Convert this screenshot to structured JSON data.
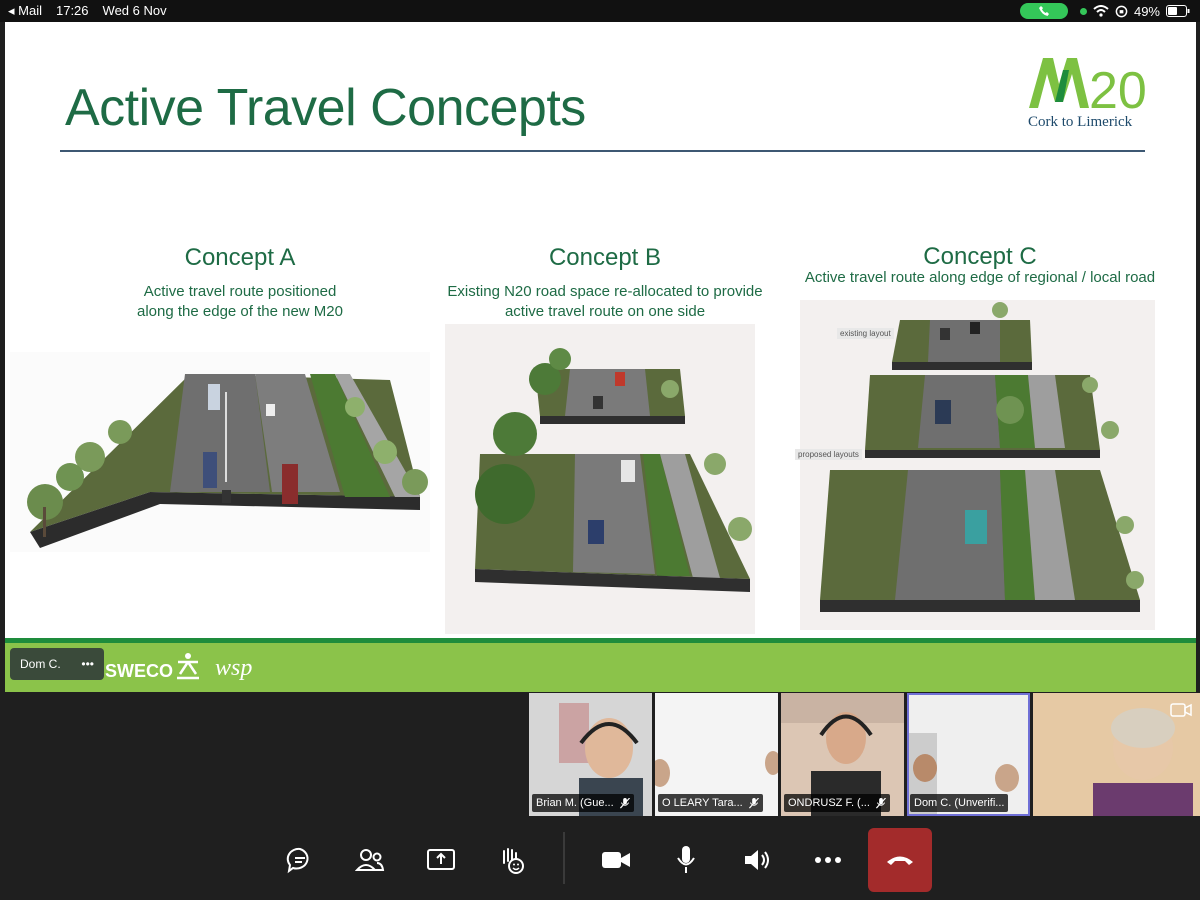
{
  "status_bar": {
    "back_app": "◂ Mail",
    "time": "17:26",
    "date": "Wed 6 Nov",
    "battery": "49%"
  },
  "slide": {
    "title": "Active Travel Concepts",
    "logo_text": "M20",
    "logo_sub": "Cork to Limerick",
    "concepts": [
      {
        "title": "Concept A",
        "desc_line1": "Active travel route positioned",
        "desc_line2": "along the edge of the new M20"
      },
      {
        "title": "Concept B",
        "desc_line1": "Existing N20 road space re-allocated to provide",
        "desc_line2": "active travel route on one side"
      },
      {
        "title": "Concept C",
        "desc_line1": "Active travel route along edge of regional / local road",
        "desc_line2": ""
      }
    ],
    "concept_c_labels": {
      "existing": "existing layout",
      "proposed": "proposed layouts"
    },
    "footer": {
      "sweco": "SWECO",
      "wsp": "wsp"
    }
  },
  "presenter": {
    "name": "Dom C.",
    "more": "•••"
  },
  "participants": [
    {
      "name": "Brian M. (Gue...",
      "muted": true,
      "bg": "#cfcfcf"
    },
    {
      "name": "O LEARY Tara...",
      "muted": true,
      "bg": "#f2f2f2"
    },
    {
      "name": "ONDRUSZ F. (...",
      "muted": true,
      "bg": "#d9c6b8"
    },
    {
      "name": "Dom C. (Unverifi...",
      "muted": false,
      "bg": "#eeeeee"
    },
    {
      "name": "",
      "muted": false,
      "bg": "#e3c9a5"
    }
  ],
  "colors": {
    "green_title": "#1e6b45",
    "footer_green": "#8bc34a",
    "hangup_red": "#a32b2b"
  }
}
